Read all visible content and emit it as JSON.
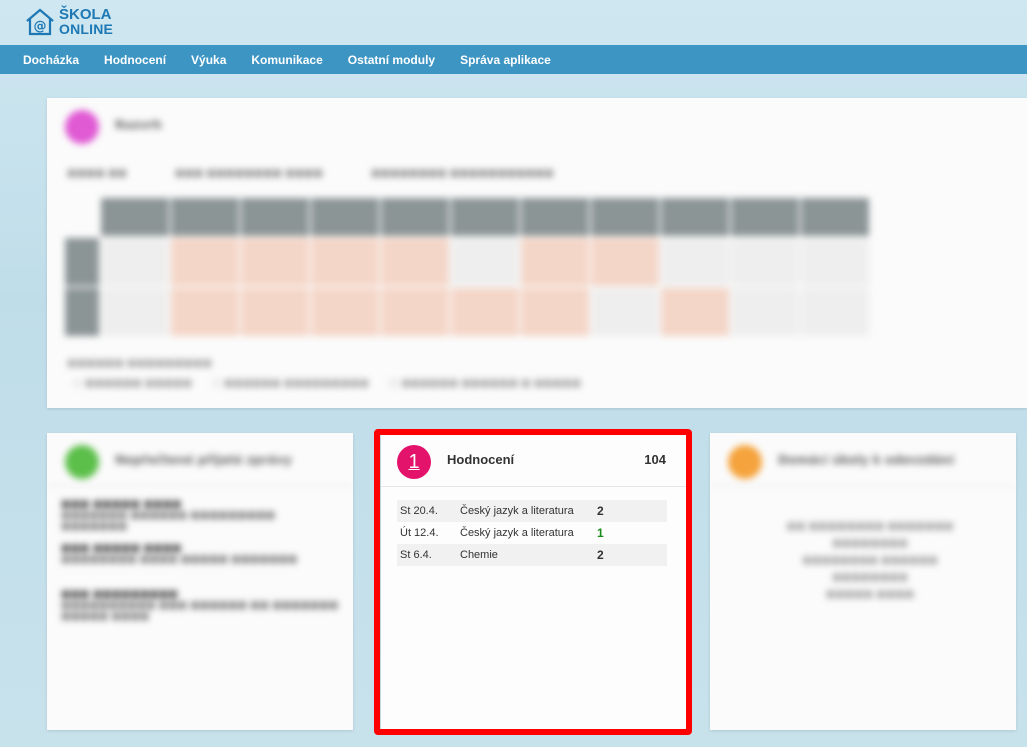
{
  "logo": {
    "line1": "ŠKOLA",
    "line2": "ONLINE",
    "brand_color": "#1d78b4"
  },
  "nav": {
    "items": [
      {
        "label": "Docházka"
      },
      {
        "label": "Hodnocení"
      },
      {
        "label": "Výuka"
      },
      {
        "label": "Komunikace"
      },
      {
        "label": "Ostatní moduly"
      },
      {
        "label": "Správa aplikace"
      }
    ],
    "bg_color": "#3d95c4"
  },
  "timetable_card": {
    "title": "Rozvrh",
    "accent": "#e05ad4"
  },
  "messages_card": {
    "title": "Nepřečtené přijaté zprávy",
    "accent": "#5cbf4a"
  },
  "homework_card": {
    "title": "Domácí úkoly k odevzdání",
    "accent": "#f5a33c"
  },
  "evaluation_card": {
    "title": "Hodnocení",
    "icon_glyph": "1",
    "icon_color": "#e3126b",
    "count": "104",
    "rows": [
      {
        "date": "St 20.4.",
        "subject": "Český jazyk a literatura",
        "grade": "2",
        "grade_color": "default"
      },
      {
        "date": "Út 12.4.",
        "subject": "Český jazyk a literatura",
        "grade": "1",
        "grade_color": "green"
      },
      {
        "date": "St 6.4.",
        "subject": "Chemie",
        "grade": "2",
        "grade_color": "default"
      }
    ]
  },
  "highlight_color": "#ff0000"
}
